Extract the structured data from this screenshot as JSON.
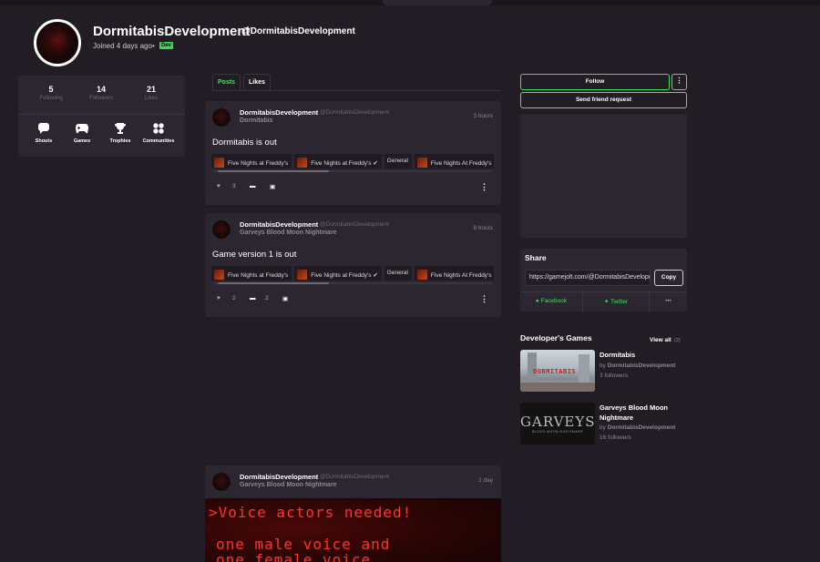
{
  "profile": {
    "display_name": "DormitabisDevelopment",
    "handle": "@DormitabisDevelopment",
    "joined": "Joined 4 days ago",
    "separator": "•",
    "badge": "Dev"
  },
  "stats": [
    {
      "value": "5",
      "label": "Following"
    },
    {
      "value": "14",
      "label": "Followers"
    },
    {
      "value": "21",
      "label": "Likes"
    }
  ],
  "nav": [
    {
      "label": "Shouts",
      "icon": "speech-bubble-icon"
    },
    {
      "label": "Games",
      "icon": "gamepad-icon"
    },
    {
      "label": "Trophies",
      "icon": "trophy-icon"
    },
    {
      "label": "Communities",
      "icon": "communities-icon"
    }
  ],
  "tabs": {
    "posts": "Posts",
    "likes": "Likes"
  },
  "posts": [
    {
      "author": "DormitabisDevelopment",
      "handle": "@DormitabisDevelopment",
      "game": "Dormitabis",
      "time": "3 hours",
      "text": "Dormitabis is out",
      "tags": [
        "Five Nights at Freddy's",
        "Five Nights at Freddy's",
        "General",
        "Five Nights At Freddy's"
      ],
      "likes": "3",
      "comments": ""
    },
    {
      "author": "DormitabisDevelopment",
      "handle": "@DormitabisDevelopment",
      "game": "Garveys Blood Moon Nightmare",
      "time": "9 hours",
      "text": "Game version 1 is out",
      "tags": [
        "Five Nights at Freddy's",
        "Five Nights at Freddy's",
        "General",
        "Five Nights At Freddy's"
      ],
      "likes": "2",
      "comments": "2"
    },
    {
      "author": "DormitabisDevelopment",
      "handle": "@DormitabisDevelopment",
      "game": "Garveys Blood Moon Nightmare",
      "time": "1 day",
      "image_lines": [
        ">Voice actors needed!",
        "one male voice and",
        "one female voice"
      ]
    }
  ],
  "sidebar": {
    "follow": "Follow",
    "more": "⋮",
    "friend_request": "Send friend request",
    "share_title": "Share",
    "share_url": "https://gamejolt.com/@DormitabisDevelopment",
    "copy": "Copy",
    "facebook": "Facebook",
    "twitter": "Twitter",
    "more_share": "•••"
  },
  "dev_games": {
    "title": "Developer's Games",
    "view_all": "View all",
    "view_all_count": "(2)",
    "by": "by",
    "games": [
      {
        "title": "Dormitabis",
        "developer": "DormitabisDevelopment",
        "followers": "3 followers",
        "thumb_text": "DORMITABIS"
      },
      {
        "title": "Garveys Blood Moon Nightmare",
        "developer": "DormitabisDevelopment",
        "followers": "16 followers",
        "thumb_text": "GARVEYS",
        "thumb_sub": "BLOOD MOON NIGHTMARE"
      }
    ]
  },
  "colors": {
    "accent": "#3ee05d",
    "background": "#221d25",
    "card": "#2b2630"
  }
}
